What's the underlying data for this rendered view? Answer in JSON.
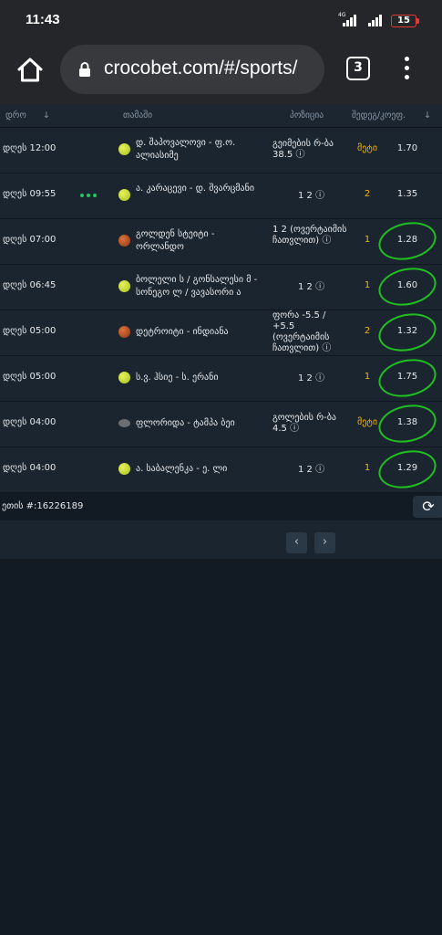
{
  "status_bar": {
    "time": "11:43",
    "network": "4G",
    "battery": "15"
  },
  "browser": {
    "url": "crocobet.com/#/sports/",
    "tab_count": "3"
  },
  "table": {
    "headers": {
      "date": "დრო",
      "date_sort": "↓",
      "match": "თამაში",
      "position": "პოზიცია",
      "bet": "შედეგ/კოეფ.",
      "bet_sort": "↓"
    },
    "rows": [
      {
        "date": "დღეს  12:00",
        "live": false,
        "sport": "tennis",
        "match": "დ. შაპოვალოვი - ფ.ო. ალიასიმე",
        "position": "გეიმების რ-ბა 38.5 ⓘ",
        "outcome": "მეტი",
        "odds": "1.70",
        "circled": false
      },
      {
        "date": "დღეს  09:55",
        "live": true,
        "sport": "tennis",
        "match": "ა. კარაცევი - დ. შვარცმანი",
        "position": "1 2 ⓘ",
        "outcome": "2",
        "odds": "1.35",
        "circled": false
      },
      {
        "date": "დღეს  07:00",
        "live": false,
        "sport": "basketball",
        "match": "გოლდენ სტეიტი - ორლანდო",
        "position": "1 2 (ოვერტაიმის ჩათვლით) ⓘ",
        "outcome": "1",
        "odds": "1.28",
        "circled": true
      },
      {
        "date": "დღეს  06:45",
        "live": false,
        "sport": "tennis",
        "match": "ბოლელი ს / გონსალესი მ - სონეგო ლ / ვავასორი ა",
        "position": "1 2 ⓘ",
        "outcome": "1",
        "odds": "1.60",
        "circled": true
      },
      {
        "date": "დღეს  05:00",
        "live": false,
        "sport": "basketball",
        "match": "დეტროიტი - ინდიანა",
        "position": "ფორა -5.5 / +5.5 (ოვერტაიმის ჩათვლით) ⓘ",
        "outcome": "2",
        "odds": "1.32",
        "circled": true
      },
      {
        "date": "დღეს  05:00",
        "live": false,
        "sport": "tennis",
        "match": "ს.ვ. ჰსიე - ს. ერანი",
        "position": "1 2 ⓘ",
        "outcome": "1",
        "odds": "1.75",
        "circled": true
      },
      {
        "date": "დღეს  04:00",
        "live": false,
        "sport": "hockey",
        "match": "ფლორიდა - ტამპა ბეი",
        "position": "გოლების რ-ბა 4.5 ⓘ",
        "outcome": "მეტი",
        "odds": "1.38",
        "circled": true
      },
      {
        "date": "დღეს  04:00",
        "live": false,
        "sport": "tennis",
        "match": "ა. საბალენკა - ე. ლი",
        "position": "1 2 ⓘ",
        "outcome": "1",
        "odds": "1.29",
        "circled": true
      }
    ]
  },
  "ticket": {
    "label": "ეთის #:16226189"
  },
  "pagination": {
    "prev": "‹",
    "next": "›"
  },
  "colors": {
    "accent_yellow": "#f5b400",
    "circle_green": "#1fc01f",
    "live_green": "#22c55e"
  }
}
